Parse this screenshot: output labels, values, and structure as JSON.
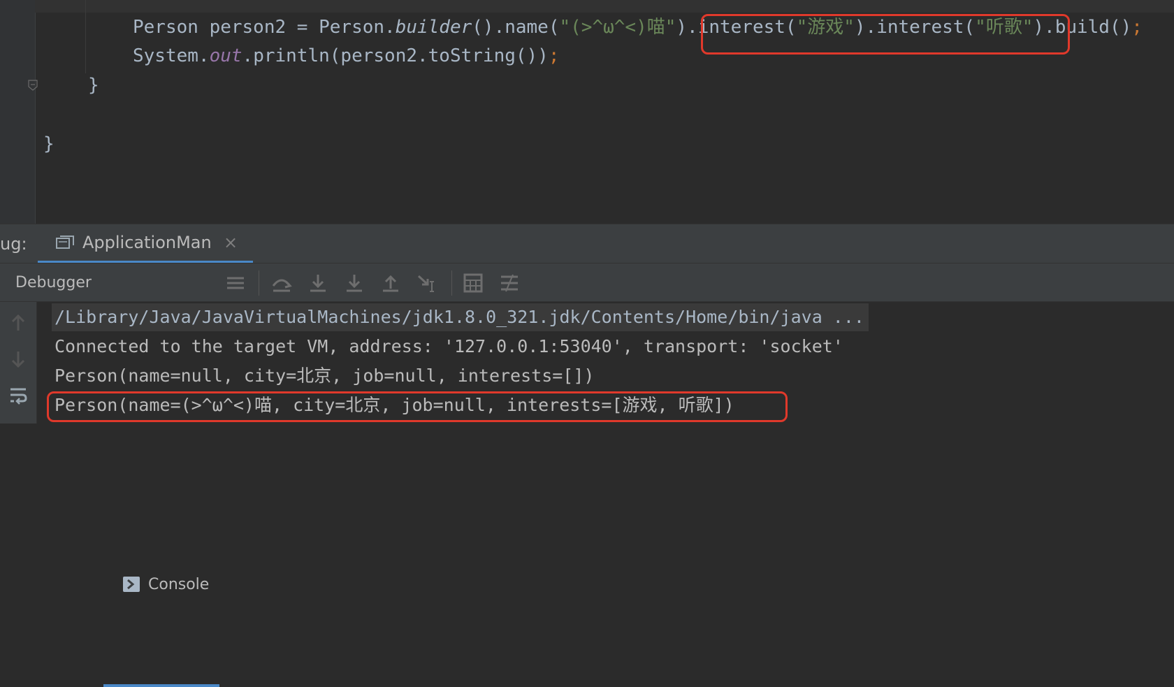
{
  "editor": {
    "line1": {
      "t1": "Person person2 = Person.",
      "builder": "builder",
      "t2": "().name(",
      "s1": "\"(>^ω^<)喵\"",
      "t3": ").interest(",
      "s2": "\"游戏\"",
      "t4": ").interest(",
      "s3": "\"听歌\"",
      "t5": ").build()",
      "semi": ";"
    },
    "line2": {
      "t1": "System.",
      "out": "out",
      "t2": ".println(person2.toString())",
      "semi": ";"
    },
    "line3": "}",
    "line4": "}"
  },
  "debug": {
    "label": "ug:",
    "session_tab": "ApplicationMan",
    "close_glyph": "×",
    "tabs": {
      "debugger": "Debugger",
      "console": "Console"
    },
    "toolbar_icons": [
      "menu-icon",
      "show-execution-point-icon",
      "step-over-icon",
      "step-into-icon",
      "force-step-into-icon",
      "step-out-icon",
      "run-to-cursor-icon",
      "evaluate-expression-icon",
      "trace-stream-icon"
    ]
  },
  "console": {
    "lines": [
      "/Library/Java/JavaVirtualMachines/jdk1.8.0_321.jdk/Contents/Home/bin/java ...",
      "Connected to the target VM, address: '127.0.0.1:53040', transport: 'socket'",
      "Person(name=null, city=北京, job=null, interests=[])",
      "Person(name=(>^ω^<)喵, city=北京, job=null, interests=[游戏, 听歌])"
    ]
  },
  "colors": {
    "editor_bg": "#2b2b2b",
    "panel_bg": "#3c3f41",
    "text": "#a9b7c6",
    "string": "#6a8759",
    "keyword": "#cc7832",
    "static_field": "#9876aa",
    "highlight_box": "#e0392b",
    "tab_underline": "#4a88c7"
  }
}
